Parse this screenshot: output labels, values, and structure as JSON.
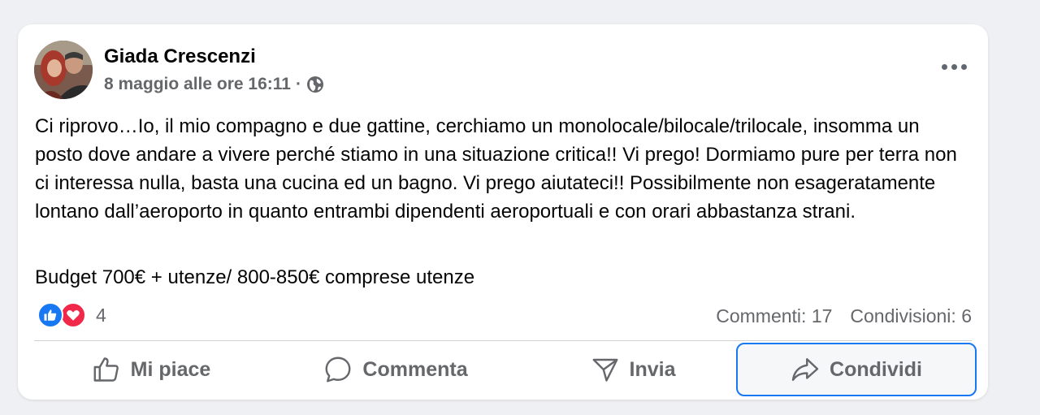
{
  "post": {
    "author": "Giada Crescenzi",
    "date": "8 maggio alle ore 16:11",
    "separator": "·",
    "audience_icon": "globe-icon",
    "more_icon": "more-options-icon",
    "text": "Ci riprovo…Io, il mio compagno e due gattine, cerchiamo un monolocale/bilocale/trilocale, insomma un posto dove andare a vivere perché stiamo in una situazione critica!! Vi prego! Dormiamo pure per terra non ci interessa nulla, basta una cucina ed un bagno. Vi prego aiutateci!! Possibilmente non esageratamente lontano dall’aeroporto in quanto entrambi dipendenti aeroportuali e con orari abbastanza strani.",
    "budget": "Budget 700€ + utenze/ 800-850€ comprese utenze"
  },
  "reactions": {
    "types": [
      "like",
      "love"
    ],
    "count": "4"
  },
  "stats": {
    "comments": "Commenti: 17",
    "shares": "Condivisioni: 6"
  },
  "actions": {
    "like": "Mi piace",
    "comment": "Commenta",
    "send": "Invia",
    "share": "Condividi"
  },
  "colors": {
    "like_blue": "#1877f2",
    "love_red": "#f02849",
    "secondary_text": "#65676b"
  }
}
